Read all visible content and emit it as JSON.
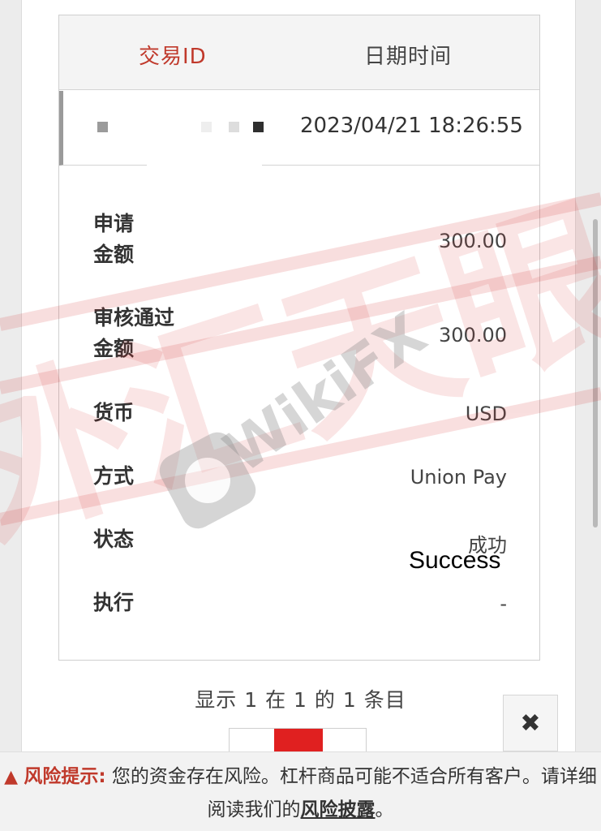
{
  "table": {
    "header": {
      "id_label": "交易ID",
      "date_label": "日期时间"
    },
    "row": {
      "datetime": "2023/04/21 18:26:55"
    },
    "details": [
      {
        "label": "申请\n金额",
        "value": "300.00"
      },
      {
        "label": "审核通过\n金额",
        "value": "300.00"
      },
      {
        "label": "货币",
        "value": "USD"
      },
      {
        "label": "方式",
        "value": "Union Pay"
      },
      {
        "label": "状态",
        "value": "成功"
      },
      {
        "label": "执行",
        "value": "-"
      }
    ],
    "status_annotation": "Success"
  },
  "pagination": {
    "summary": "显示 1 在 1 的 1 条目"
  },
  "close_button": {
    "symbol": "✖"
  },
  "risk_notice": {
    "icon": "warning-icon",
    "label": "风险提示:",
    "text_1": " 您的资金存在风险。杠杆商品可能不适合所有客户。请详细阅读我们的",
    "link": "风险披露",
    "text_2": "。"
  },
  "watermark": {
    "brand": "WikiFX",
    "cn_text": "外汇天眼"
  },
  "colors": {
    "accent": "#c0392b",
    "pager_active": "#e02020"
  }
}
